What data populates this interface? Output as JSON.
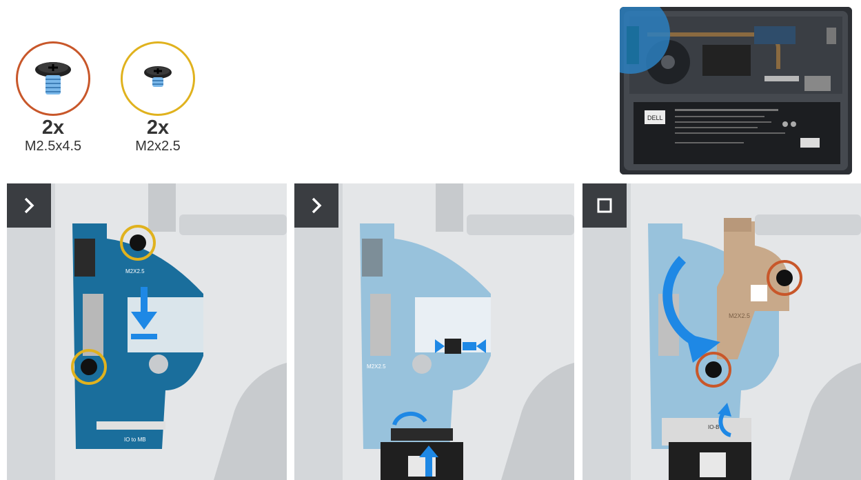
{
  "screws": [
    {
      "qty": "2x",
      "label": "M2.5x4.5",
      "ring_color": "#c8572a"
    },
    {
      "qty": "2x",
      "label": "M2x2.5",
      "ring_color": "#e0b21e"
    }
  ],
  "colors": {
    "accent_blue": "#1e88e5",
    "board_blue": "#1a6e9c",
    "orange_ring": "#c8572a",
    "gold_ring": "#e0b21e",
    "step_bg": "#3a3d41"
  },
  "steps": [
    {
      "icon": "chevron-right-icon",
      "board_silk": "IO to MB",
      "screw_silk": "M2X2.5"
    },
    {
      "icon": "chevron-right-icon",
      "board_silk": "",
      "screw_silk": "M2X2.5"
    },
    {
      "icon": "stop-square-icon",
      "board_silk": "IO-B",
      "screw_silk": "M2X2.5"
    }
  ],
  "overview": {
    "brand": "DELL"
  }
}
